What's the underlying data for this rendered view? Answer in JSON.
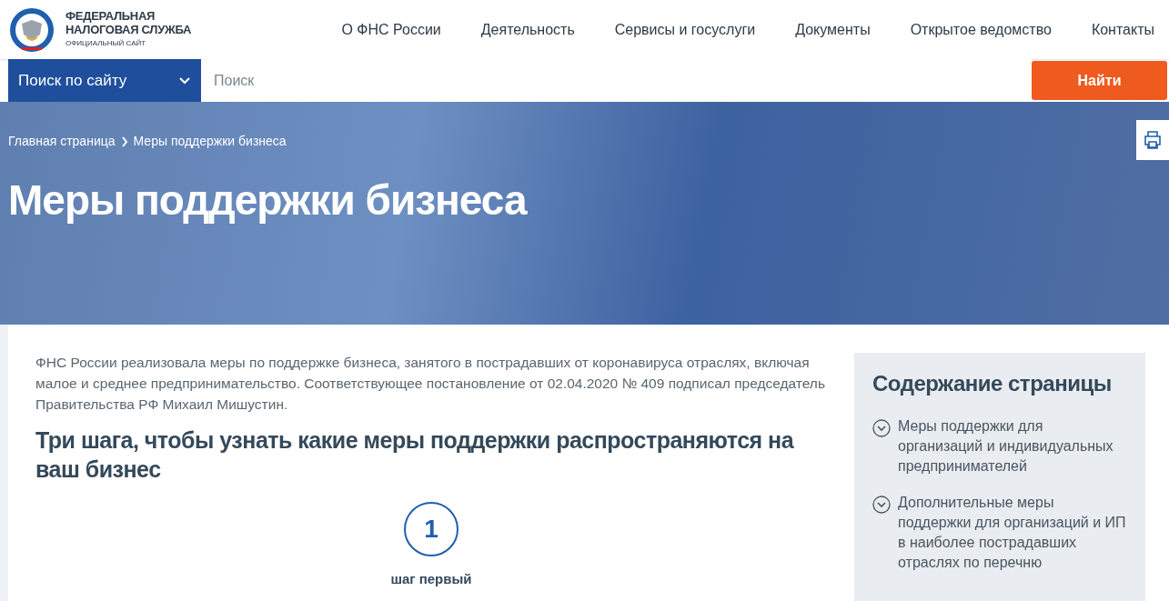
{
  "logo": {
    "line_1": "ФЕДЕРАЛЬНАЯ",
    "line_2": "НАЛОГОВАЯ СЛУЖБА",
    "subtitle": "ОФИЦИАЛЬНЫЙ САЙТ"
  },
  "nav": [
    "О ФНС России",
    "Деятельность",
    "Сервисы и госуслуги",
    "Документы",
    "Открытое ведомство",
    "Контакты"
  ],
  "search": {
    "scope": "Поиск по сайту",
    "placeholder": "Поиск",
    "button": "Найти"
  },
  "breadcrumbs": [
    "Главная страница",
    "Меры поддержки бизнеса"
  ],
  "page_title": "Меры поддержки бизнеса",
  "intro": "ФНС России реализовала меры по поддержке бизнеса, занятого в пострадавших от коронавируса отраслях, включая малое и среднее предпринимательство. Соответствующее постановление от 02.04.2020 № 409 подписал председатель Правительства РФ Михаил Мишустин.",
  "steps_heading": "Три шага, чтобы узнать какие меры поддержки распространяются на ваш бизнес",
  "step": {
    "number": "1",
    "label": "шаг первый"
  },
  "toc": {
    "title": "Содержание страницы",
    "items": [
      "Меры поддержки для организаций и индивидуальных предпринимателей",
      "Дополнительные меры поддержки для организаций и ИП в наиболее пострадавших отраслях по перечню"
    ]
  }
}
